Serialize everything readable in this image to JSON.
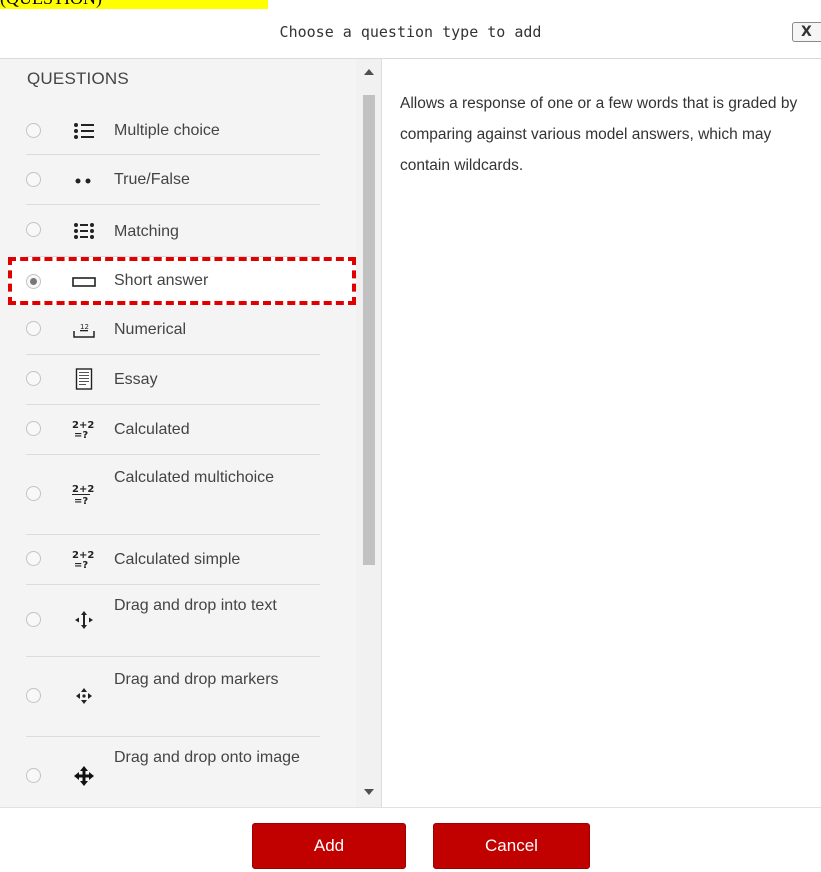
{
  "top_highlight_text": "(QUESTION)",
  "dialog": {
    "title": "Choose a question type to add",
    "close_label": "X"
  },
  "options": {
    "section_label": "QUESTIONS",
    "selected": "Short answer",
    "items": [
      {
        "label": "Multiple choice",
        "icon": "list-icon"
      },
      {
        "label": "True/False",
        "icon": "two-dots-icon"
      },
      {
        "label": "Matching",
        "icon": "matching-icon"
      },
      {
        "label": "Short answer",
        "icon": "textbox-icon"
      },
      {
        "label": "Numerical",
        "icon": "numerical-icon"
      },
      {
        "label": "Essay",
        "icon": "document-icon"
      },
      {
        "label": "Calculated",
        "icon": "formula-icon"
      },
      {
        "label": "Calculated multichoice",
        "icon": "formula-icon"
      },
      {
        "label": "Calculated simple",
        "icon": "formula-icon"
      },
      {
        "label": "Drag and drop into text",
        "icon": "move-icon"
      },
      {
        "label": "Drag and drop markers",
        "icon": "move-icon"
      },
      {
        "label": "Drag and drop onto image",
        "icon": "move-bold-icon"
      }
    ]
  },
  "description": "Allows a response of one or a few words that is graded by comparing against various model answers, which may contain wildcards.",
  "buttons": {
    "add": "Add",
    "cancel": "Cancel"
  },
  "colors": {
    "primary_button": "#c10000",
    "selection_outline": "#e00000",
    "highlight": "#ffff00"
  }
}
